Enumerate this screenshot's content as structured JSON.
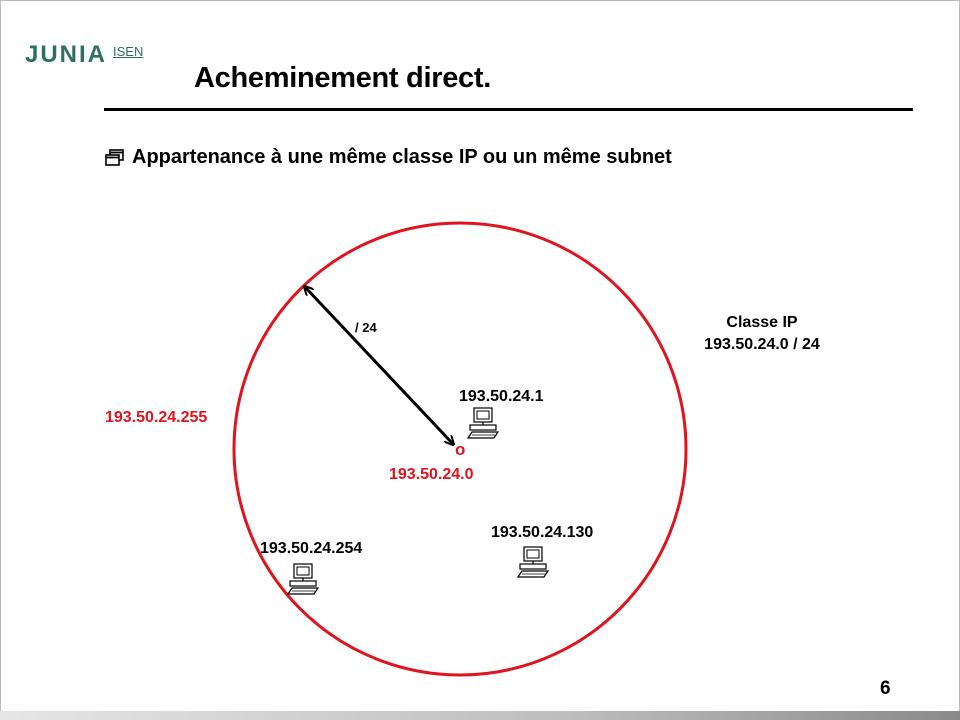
{
  "logo": {
    "main": "JUNIA",
    "sub": "ISEN"
  },
  "title": "Acheminement direct.",
  "bullet": {
    "icon": "window-restore-icon",
    "text": "Appartenance à une même classe IP ou un même subnet"
  },
  "diagram": {
    "circle_color": "#e0141e",
    "radius_label": "/ 24",
    "center_marker": "o",
    "center_address": "193.50.24.0",
    "broadcast_address": "193.50.24.255",
    "class_label": {
      "line1": "Classe IP",
      "line2": "193.50.24.0 / 24"
    },
    "hosts": [
      {
        "address": "193.50.24.1",
        "icon": "computer-icon"
      },
      {
        "address": "193.50.24.130",
        "icon": "computer-icon"
      },
      {
        "address": "193.50.24.254",
        "icon": "computer-icon"
      }
    ]
  },
  "page_number": "6"
}
